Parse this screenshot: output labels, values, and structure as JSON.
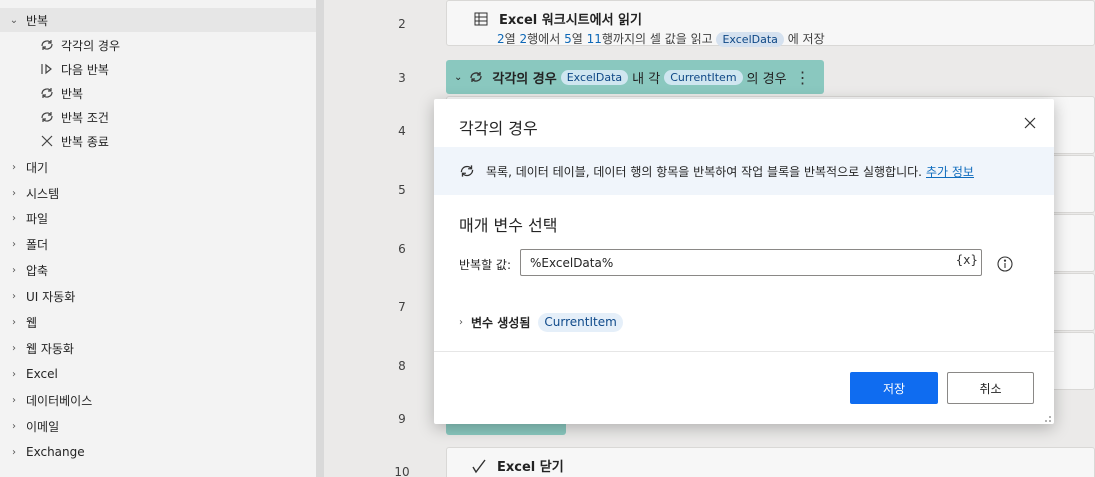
{
  "sidebar": {
    "loop_group": "반복",
    "loop_items": [
      {
        "label": "각각의 경우",
        "icon": "loop-icon"
      },
      {
        "label": "다음 반복",
        "icon": "next-loop-icon"
      },
      {
        "label": "반복",
        "icon": "loop-icon"
      },
      {
        "label": "반복 조건",
        "icon": "loop-icon"
      },
      {
        "label": "반복 종료",
        "icon": "close-icon"
      }
    ],
    "groups": [
      "대기",
      "시스템",
      "파일",
      "폴더",
      "압축",
      "UI 자동화",
      "웹",
      "웹 자동화",
      "Excel",
      "데이터베이스",
      "이메일",
      "Exchange"
    ]
  },
  "flow": {
    "line_numbers": [
      "2",
      "3",
      "4",
      "5",
      "6",
      "7",
      "8",
      "9",
      "10"
    ],
    "step2": {
      "title": "Excel 워크시트에서 읽기",
      "d_col1": "2",
      "d_t1": "열 ",
      "d_row1": "2",
      "d_t2": "행에서 ",
      "d_col2": "5",
      "d_t3": "열 ",
      "d_row2": "11",
      "d_t4": "행까지의 셀 값을 읽고 ",
      "d_var": "ExcelData",
      "d_t5": " 에 저장"
    },
    "step3": {
      "title": "각각의 경우",
      "var1": "ExcelData",
      "mid": "내 각",
      "var2": "CurrentItem",
      "end": "의 경우"
    },
    "step10": {
      "title": "Excel 닫기"
    }
  },
  "dialog": {
    "title": "각각의 경우",
    "info_text": "목록, 데이터 테이블, 데이터 행의 항목을 반복하여 작업 블록을 반복적으로 실행합니다.",
    "info_link": "추가 정보",
    "section_title": "매개 변수 선택",
    "field_label": "반복할 값:",
    "field_value": "%ExcelData%",
    "var_button": "{x}",
    "expander_label": "변수 생성됨",
    "expander_var": "CurrentItem",
    "save_label": "저장",
    "cancel_label": "취소"
  },
  "colors": {
    "accent": "#0f6cf0",
    "loop_block": "#8fcfc6",
    "link": "#0f6cbd"
  }
}
